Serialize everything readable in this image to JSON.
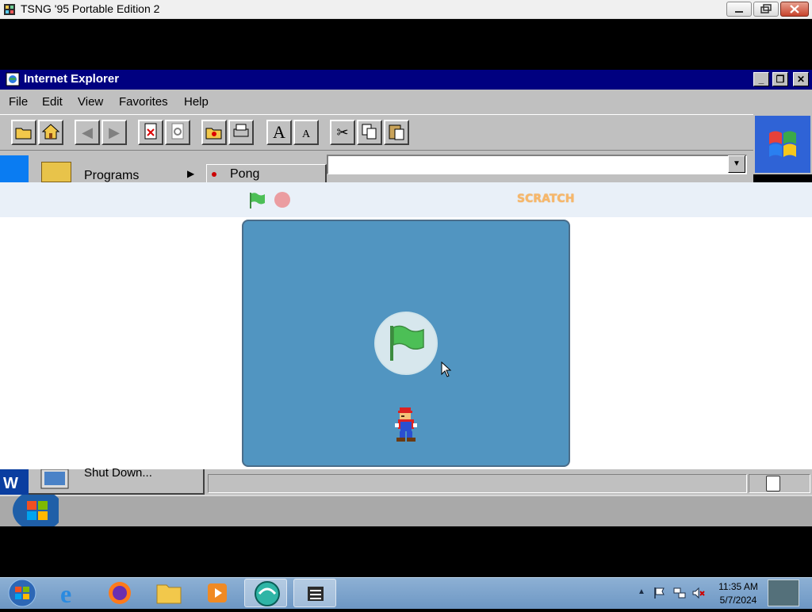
{
  "outer_window": {
    "title": "TSNG '95 Portable Edition 2"
  },
  "ie": {
    "title": "Internet Explorer",
    "menu": [
      "File",
      "Edit",
      "View",
      "Favorites",
      "Help"
    ],
    "toolbar_icons": [
      "open-folder-icon",
      "home-icon",
      "back-icon",
      "forward-icon",
      "stop-icon",
      "refresh-icon",
      "favorites-folder-icon",
      "print-icon",
      "larger-font-icon",
      "smaller-font-icon",
      "cut-icon",
      "copy-icon",
      "paste-icon"
    ],
    "address_value": ""
  },
  "start_menu": {
    "programs_label": "Programs",
    "submenu_item": "Pong",
    "shutdown_label": "Shut Down..."
  },
  "scratch": {
    "logo_text": "SCRATCH",
    "flag_color": "#4cbf56",
    "stop_color": "#ec5959",
    "stage_color": "#5195c1"
  },
  "host_taskbar": {
    "apps": [
      "ie-icon",
      "firefox-icon",
      "explorer-icon",
      "media-player-icon",
      "tsng-app-icon",
      "terminal-app-icon"
    ],
    "time": "11:35 AM",
    "date": "5/7/2024"
  }
}
